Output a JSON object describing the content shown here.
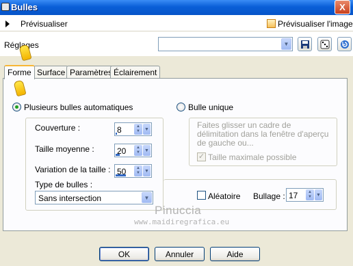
{
  "window": {
    "title": "Bulles",
    "close_glyph": "X"
  },
  "preview_bar": {
    "preview_label": "Prévisualiser",
    "preview_image_label": "Prévisualiser l'image",
    "preview_image_checked": true
  },
  "presets": {
    "label": "Réglages",
    "value": ""
  },
  "tabs": [
    {
      "label": "Forme",
      "active": true
    },
    {
      "label": "Surface",
      "active": false
    },
    {
      "label": "Paramètres",
      "active": false
    },
    {
      "label": "Éclairement",
      "active": false
    }
  ],
  "forme": {
    "auto_bubbles": {
      "label": "Plusieurs bulles automatiques",
      "selected": true,
      "coverage_label": "Couverture :",
      "coverage_value": "8",
      "coverage_level": 0.08,
      "avg_size_label": "Taille moyenne :",
      "avg_size_value": "20",
      "avg_size_level": 0.2,
      "size_variation_label": "Variation de la taille :",
      "size_variation_value": "50",
      "size_variation_level": 0.5,
      "type_label": "Type de bulles :",
      "type_value": "Sans intersection"
    },
    "single_bubble": {
      "label": "Bulle unique",
      "selected": false,
      "hint": "Faites glisser un cadre de délimitation dans la fenêtre d'aperçu de gauche ou...",
      "max_size_label": "Taille maximale possible",
      "max_size_checked": true
    },
    "random_label": "Aléatoire",
    "random_checked": false,
    "bubbling_label": "Bullage :",
    "bubbling_value": "17"
  },
  "watermark": {
    "line1": "Pinuccia",
    "line2": "www.maidiregrafica.eu"
  },
  "buttons": {
    "ok": "OK",
    "cancel": "Annuler",
    "help": "Aide"
  },
  "colors": {
    "title_bar": "#0a5fd8",
    "dialog_bg": "#ece9d8",
    "check_green": "#21a121",
    "tab_highlight": "#f7b636"
  }
}
